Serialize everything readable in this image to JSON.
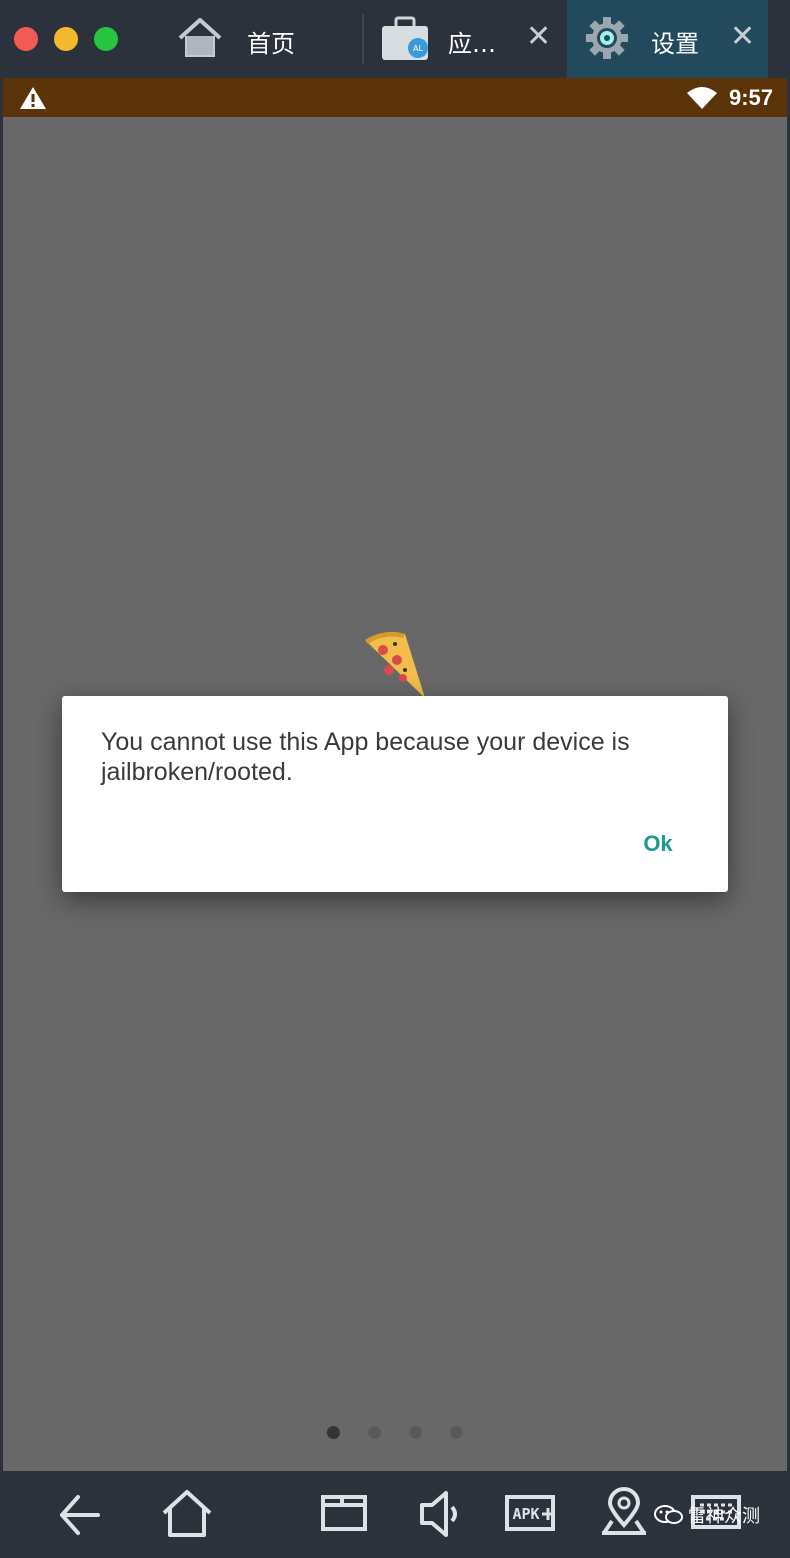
{
  "window": {
    "tabs": [
      {
        "label": "首页",
        "icon": "home-icon",
        "closable": false
      },
      {
        "label": "应…",
        "icon": "app-bag-icon",
        "closable": true
      },
      {
        "label": "设置",
        "icon": "gear-icon",
        "closable": true,
        "active": true
      }
    ],
    "close_glyph": "✕"
  },
  "statusbar": {
    "time": "9:57",
    "icons": [
      "warning-icon",
      "wifi-icon"
    ]
  },
  "dialog": {
    "message": "You cannot use this App because your device is jailbroken/rooted.",
    "ok_label": "Ok"
  },
  "pager": {
    "count": 4,
    "active_index": 0
  },
  "navbar": {
    "buttons": [
      "back-icon",
      "home-icon",
      "window-icon",
      "volume-icon",
      "apk-install-icon",
      "location-icon",
      "keyboard-icon"
    ],
    "apk_label": "APK"
  },
  "watermark": {
    "text": "雷神众测"
  },
  "colors": {
    "titlebar": "#2b323c",
    "active_tab": "#234a5c",
    "statusbar": "#5a3309",
    "screen_overlay": "#686868",
    "accent": "#1d9b8e"
  }
}
